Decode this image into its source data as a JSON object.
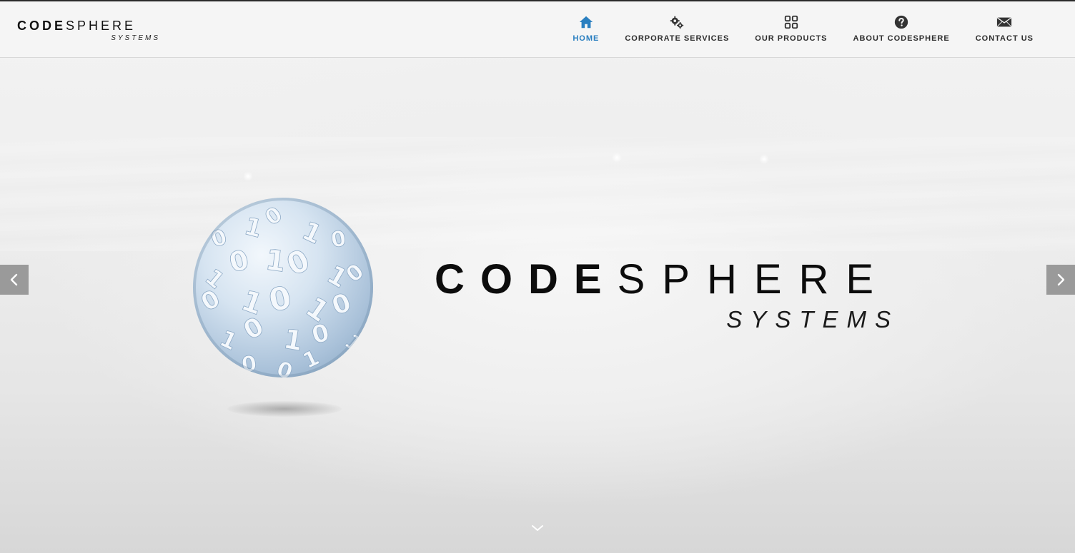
{
  "header": {
    "logo": {
      "bold_part": "CODE",
      "light_part": "SPHERE",
      "subtitle": "SYSTEMS"
    },
    "nav": [
      {
        "label": "HOME",
        "icon": "home-icon",
        "active": true
      },
      {
        "label": "CORPORATE SERVICES",
        "icon": "gears-icon",
        "active": false
      },
      {
        "label": "OUR PRODUCTS",
        "icon": "grid-icon",
        "active": false
      },
      {
        "label": "ABOUT CODESPHERE",
        "icon": "question-circle-icon",
        "active": false
      },
      {
        "label": "CONTACT US",
        "icon": "envelope-icon",
        "active": false
      }
    ]
  },
  "hero": {
    "title_bold": "CODE",
    "title_light": "SPHERE",
    "subtitle": "SYSTEMS",
    "image": "binary-digits-sphere",
    "prev_icon": "chevron-left-icon",
    "next_icon": "chevron-right-icon",
    "scroll_icon": "chevron-down-icon"
  },
  "colors": {
    "accent": "#2a7fc0",
    "nav_text": "#2d2d2d",
    "arrow_bg": "#9a9a9a",
    "sphere": "#a9c1d9"
  }
}
